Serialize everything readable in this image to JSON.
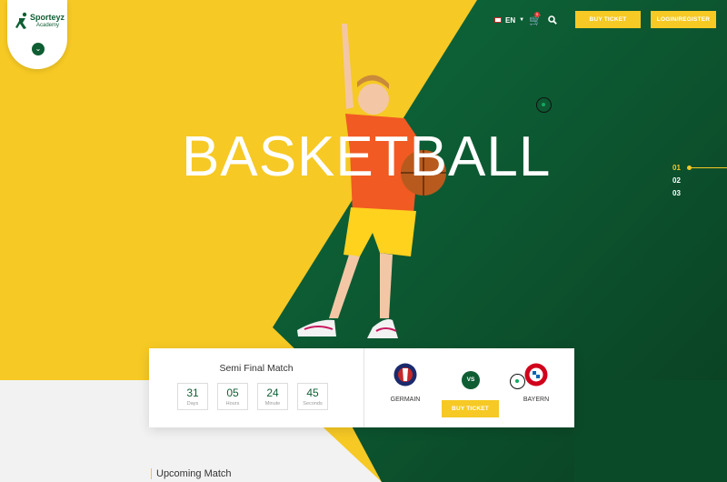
{
  "brand": {
    "name": "Sporteyz",
    "subtitle": "Academy"
  },
  "header": {
    "language": "EN",
    "cart_count": "0",
    "buy_ticket_label": "BUY TICKET",
    "login_label": "LOGIN/REGISTER"
  },
  "hero": {
    "title": "BASKETBALL",
    "slides": [
      "01",
      "02",
      "03"
    ],
    "active_slide": "01"
  },
  "match": {
    "title": "Semi Final Match",
    "countdown": [
      {
        "value": "31",
        "label": "Days"
      },
      {
        "value": "05",
        "label": "Hours"
      },
      {
        "value": "24",
        "label": "Minute"
      },
      {
        "value": "45",
        "label": "Seconds"
      }
    ],
    "team_a": "GERMAIN",
    "team_b": "BAYERN",
    "vs_label": "VS",
    "buy_ticket_label": "BUY TICKET"
  },
  "section": {
    "upcoming_title": "Upcoming Match"
  },
  "colors": {
    "yellow": "#f6c924",
    "green": "#0f5e33",
    "white": "#ffffff"
  },
  "icons": {
    "logo": "runner-logo-icon",
    "toggle": "chevron-down-icon",
    "flag": "uk-flag-icon",
    "cart": "cart-icon",
    "search": "search-icon"
  }
}
